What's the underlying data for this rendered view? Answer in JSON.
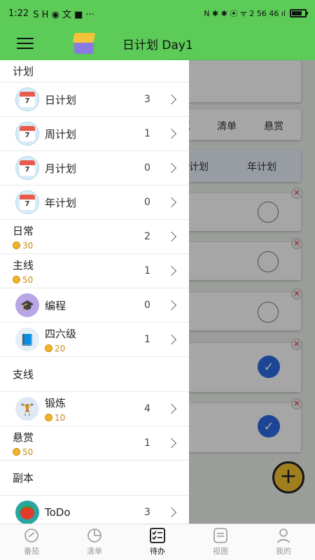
{
  "statusbar": {
    "time": "1:22",
    "left_icons": "S H ◉ 文 ■ ···",
    "right_icons": "N ✱ ✱ ⦿ ᯤ 2 56 46 ıl"
  },
  "appbar": {
    "title": "日计划 Day1"
  },
  "background": {
    "tabs1": [
      "览",
      "清单",
      "悬赏"
    ],
    "tabs2": [
      "计划",
      "年计划"
    ]
  },
  "drawer": {
    "section_plan": "计划",
    "plan_items": [
      {
        "label": "日计划",
        "count": "3",
        "icon": "calendar-icon"
      },
      {
        "label": "周计划",
        "count": "1",
        "icon": "calendar-icon"
      },
      {
        "label": "月计划",
        "count": "0",
        "icon": "calendar-icon"
      },
      {
        "label": "年计划",
        "count": "0",
        "icon": "calendar-icon"
      }
    ],
    "daily": {
      "label": "日常",
      "coins": "30",
      "count": "2"
    },
    "mainline": {
      "label": "主线",
      "coins": "50",
      "count": "1"
    },
    "coding": {
      "label": "编程",
      "count": "0"
    },
    "cet": {
      "label": "四六级",
      "coins": "20",
      "count": "1"
    },
    "section_side": "支线",
    "workout": {
      "label": "锻炼",
      "coins": "10",
      "count": "4"
    },
    "bounty": {
      "label": "悬赏",
      "coins": "50",
      "count": "1"
    },
    "section_dungeon": "副本",
    "todo": {
      "label": "ToDo",
      "count": "3"
    }
  },
  "bottomnav": [
    {
      "label": "番茄",
      "icon": "tomato-clock-icon",
      "active": false
    },
    {
      "label": "清单",
      "icon": "pie-chart-icon",
      "active": false
    },
    {
      "label": "待办",
      "icon": "checklist-icon",
      "active": true
    },
    {
      "label": "视图",
      "icon": "notes-icon",
      "active": false
    },
    {
      "label": "我的",
      "icon": "profile-icon",
      "active": false
    }
  ]
}
